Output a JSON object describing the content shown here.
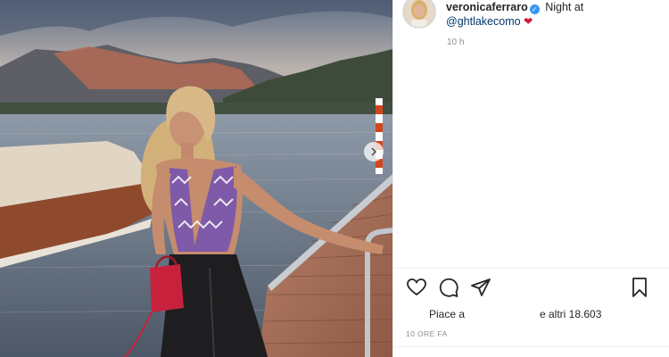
{
  "post": {
    "username": "veronicaferraro",
    "caption_text": "Night at",
    "mention": "@ghtlakecomo",
    "time_short": "10 h",
    "likes_prefix": "Piace a",
    "likes_suffix": "e altri 18.603",
    "posted_ago": "10 ORE FA"
  },
  "icons": {
    "verified": "verified-badge-icon",
    "heart_emoji": "red-heart-icon",
    "like": "heart-outline-icon",
    "comment": "comment-bubble-icon",
    "share": "paper-plane-icon",
    "save": "bookmark-icon",
    "carousel_next": "chevron-right-icon"
  },
  "colors": {
    "mention": "#00376b",
    "muted": "#8e8e8e",
    "verified": "#3897f0",
    "heart": "#d11a3a"
  }
}
